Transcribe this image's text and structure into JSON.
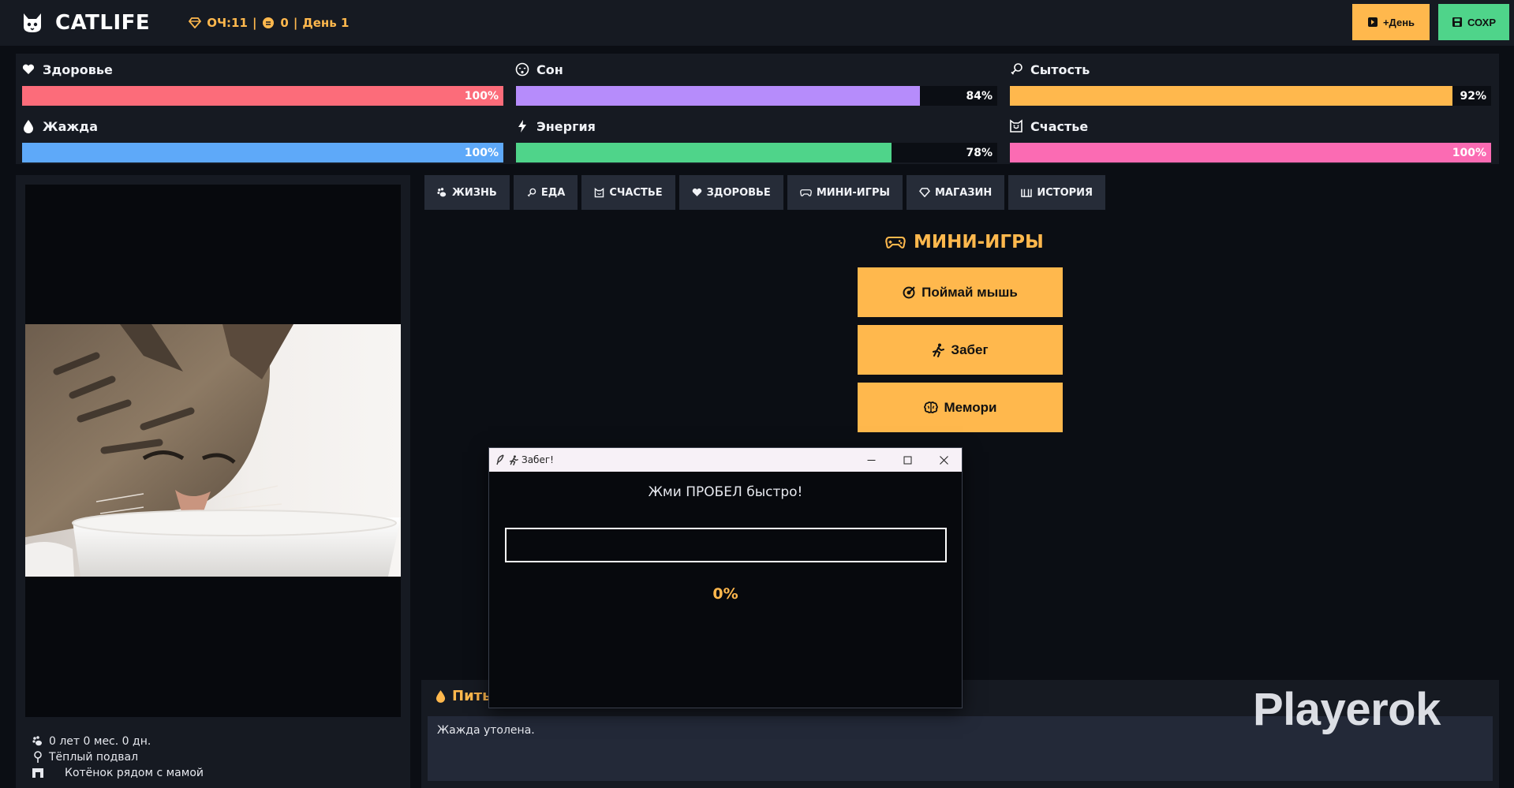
{
  "header": {
    "title": "CATLIFE",
    "points": "ОЧ:11",
    "coins": "0",
    "day": "День 1",
    "separator": "|",
    "day_button": "+День",
    "save_button": "СОХР"
  },
  "stats": [
    {
      "label": "Здоровье",
      "value": 100,
      "percent": "100%",
      "color": "#fc6c7a",
      "icon": "heart-icon"
    },
    {
      "label": "Сон",
      "value": 84,
      "percent": "84%",
      "color": "#b68cfb",
      "icon": "sleep-face-icon"
    },
    {
      "label": "Сытость",
      "value": 92,
      "percent": "92%",
      "color": "#ffb84d",
      "icon": "drumstick-icon"
    },
    {
      "label": "Жажда",
      "value": 100,
      "percent": "100%",
      "color": "#5ea9f9",
      "icon": "droplet-icon"
    },
    {
      "label": "Энергия",
      "value": 78,
      "percent": "78%",
      "color": "#4fd48a",
      "icon": "bolt-icon"
    },
    {
      "label": "Счастье",
      "value": 100,
      "percent": "100%",
      "color": "#fb6bb3",
      "icon": "cat-face-icon"
    }
  ],
  "cat": {
    "age": "0 лет 0 мес. 0 дн.",
    "location": "Тёплый подвал",
    "status": "Котёнок рядом с мамой"
  },
  "tabs": [
    {
      "label": "ЖИЗНЬ",
      "icon": "paw-icon"
    },
    {
      "label": "ЕДА",
      "icon": "drumstick-icon"
    },
    {
      "label": "СЧАСТЬЕ",
      "icon": "cat-face-icon"
    },
    {
      "label": "ЗДОРОВЬЕ",
      "icon": "heart-icon"
    },
    {
      "label": "МИНИ-ИГРЫ",
      "icon": "gamepad-icon"
    },
    {
      "label": "МАГАЗИН",
      "icon": "diamond-icon"
    },
    {
      "label": "ИСТОРИЯ",
      "icon": "book-icon"
    }
  ],
  "minigames": {
    "title": "МИНИ-ИГРЫ",
    "buttons": [
      "Поймай мышь",
      "Забег",
      "Мемори"
    ]
  },
  "log": {
    "title": "Пить",
    "message": "Жажда утолена."
  },
  "watermark": "Playerok",
  "popup": {
    "title": "Забег!",
    "prompt": "Жми ПРОБЕЛ быстро!",
    "progress": 0,
    "progress_text": "0%"
  },
  "colors": {
    "accent": "#ffb84d",
    "save": "#4fd48a",
    "panel": "#161a22",
    "background": "#0b0e14"
  }
}
